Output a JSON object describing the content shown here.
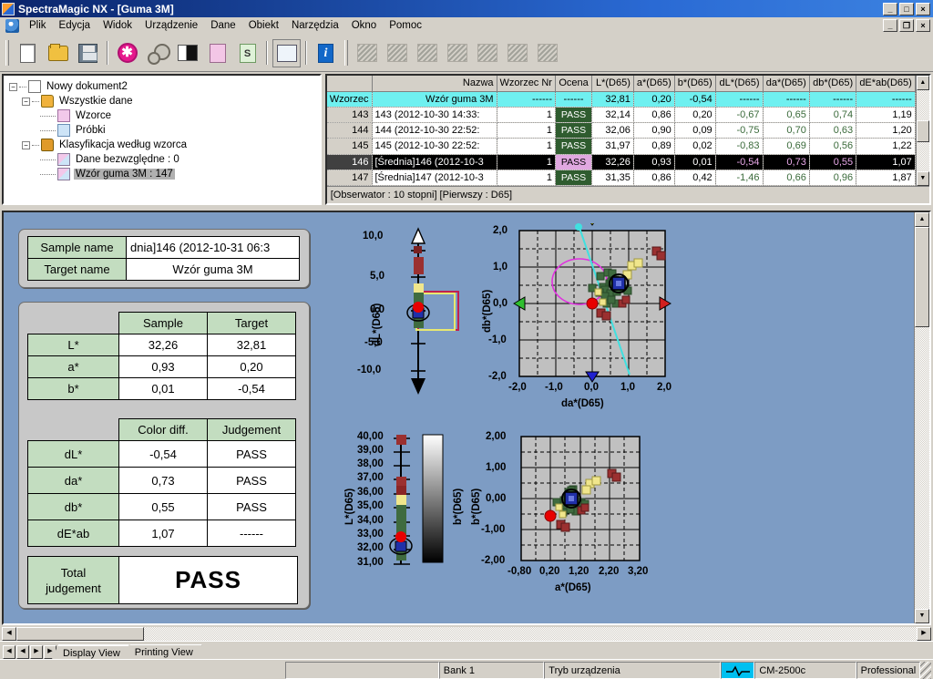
{
  "window": {
    "title": "SpectraMagic NX - [Guma 3M]",
    "app_icon": "app-icon",
    "outer_buttons": [
      "_",
      "□",
      "×"
    ],
    "inner_buttons": [
      "_",
      "❐",
      "×"
    ]
  },
  "menu": {
    "items": [
      {
        "label": "Plik"
      },
      {
        "label": "Edycja"
      },
      {
        "label": "Widok"
      },
      {
        "label": "Urządzenie"
      },
      {
        "label": "Dane"
      },
      {
        "label": "Obiekt"
      },
      {
        "label": "Narzędzia"
      },
      {
        "label": "Okno"
      },
      {
        "label": "Pomoc"
      }
    ]
  },
  "toolbar": {
    "icons": [
      "new-document-icon",
      "open-folder-icon",
      "save-disk-icon",
      "target-measure-icon",
      "gears-settings-icon",
      "black-white-sample-icon",
      "target-pink-icon",
      "sample-green-icon",
      "window-list-icon",
      "info-icon",
      "chart-icon-1",
      "chart-icon-2",
      "chart-icon-3",
      "chart-icon-4",
      "chart-icon-5",
      "chart-icon-6",
      "chart-icon-7"
    ]
  },
  "tree": {
    "nodes": [
      {
        "label": "Nowy dokument2",
        "icon": "document-icon",
        "level": 0,
        "expander": "-",
        "selected": false
      },
      {
        "label": "Wszystkie dane",
        "icon": "folder-icon",
        "level": 1,
        "expander": "-",
        "selected": false
      },
      {
        "label": "Wzorce",
        "icon": "target-page-icon",
        "level": 2,
        "expander": "",
        "selected": false
      },
      {
        "label": "Próbki",
        "icon": "sample-page-icon",
        "level": 2,
        "expander": "",
        "selected": false
      },
      {
        "label": "Klasyfikacja według wzorca",
        "icon": "folder-group-icon",
        "level": 1,
        "expander": "-",
        "selected": false
      },
      {
        "label": "Dane bezwzględne : 0",
        "icon": "dual-page-icon",
        "level": 2,
        "expander": "",
        "selected": false
      },
      {
        "label": "Wzór guma 3M : 147",
        "icon": "dual-page-icon",
        "level": 2,
        "expander": "",
        "selected": true
      }
    ]
  },
  "datagrid": {
    "columns": [
      "",
      "Nazwa",
      "Wzorzec Nr",
      "Ocena",
      "L*(D65)",
      "a*(D65)",
      "b*(D65)",
      "dL*(D65)",
      "da*(D65)",
      "db*(D65)",
      "dE*ab(D65)"
    ],
    "rows": [
      {
        "kind": "target",
        "no": "Wzorzec",
        "name": "Wzór guma 3M",
        "ref": "------",
        "judge": "------",
        "L": "32,81",
        "a": "0,20",
        "b": "-0,54",
        "dL": "------",
        "da": "------",
        "db": "------",
        "dE": "------"
      },
      {
        "kind": "sample",
        "no": "143",
        "name": "143 (2012-10-30 14:33:",
        "ref": "1",
        "judge": "PASS",
        "L": "32,14",
        "a": "0,86",
        "b": "0,20",
        "dL": "-0,67",
        "da": "0,65",
        "db": "0,74",
        "dE": "1,19"
      },
      {
        "kind": "sample",
        "no": "144",
        "name": "144 (2012-10-30 22:52:",
        "ref": "1",
        "judge": "PASS",
        "L": "32,06",
        "a": "0,90",
        "b": "0,09",
        "dL": "-0,75",
        "da": "0,70",
        "db": "0,63",
        "dE": "1,20"
      },
      {
        "kind": "sample",
        "no": "145",
        "name": "145 (2012-10-30 22:52:",
        "ref": "1",
        "judge": "PASS",
        "L": "31,97",
        "a": "0,89",
        "b": "0,02",
        "dL": "-0,83",
        "da": "0,69",
        "db": "0,56",
        "dE": "1,22"
      },
      {
        "kind": "selected",
        "no": "146",
        "name": "[Średnia]146 (2012-10-3",
        "ref": "1",
        "judge": "PASS",
        "L": "32,26",
        "a": "0,93",
        "b": "0,01",
        "dL": "-0,54",
        "da": "0,73",
        "db": "0,55",
        "dE": "1,07"
      },
      {
        "kind": "sample",
        "no": "147",
        "name": "[Średnia]147 (2012-10-3",
        "ref": "1",
        "judge": "PASS",
        "L": "31,35",
        "a": "0,86",
        "b": "0,42",
        "dL": "-1,46",
        "da": "0,66",
        "db": "0,96",
        "dE": "1,87"
      }
    ],
    "observer_line": "[Obserwator : 10 stopni]  [Pierwszy : D65]"
  },
  "display": {
    "names": {
      "sample_label": "Sample name",
      "sample_value": "dnia]146 (2012-10-31 06:3",
      "target_label": "Target name",
      "target_value": "Wzór guma 3M"
    },
    "values_table": {
      "headers": [
        "",
        "Sample",
        "Target"
      ],
      "rows": [
        {
          "label": "L*",
          "sample": "32,26",
          "target": "32,81"
        },
        {
          "label": "a*",
          "sample": "0,93",
          "target": "0,20"
        },
        {
          "label": "b*",
          "sample": "0,01",
          "target": "-0,54"
        }
      ]
    },
    "diff_table": {
      "headers": [
        "",
        "Color diff.",
        "Judgement"
      ],
      "rows": [
        {
          "label": "dL*",
          "value": "-0,54",
          "judgement": "PASS"
        },
        {
          "label": "da*",
          "value": "0,73",
          "judgement": "PASS"
        },
        {
          "label": "db*",
          "value": "0,55",
          "judgement": "PASS"
        },
        {
          "label": "dE*ab",
          "value": "1,07",
          "judgement": "------"
        }
      ]
    },
    "total": {
      "label_line1": "Total",
      "label_line2": "judgement",
      "value": "PASS"
    }
  },
  "chart_data": [
    {
      "type": "scatter",
      "name": "dL-axis-gauge",
      "title": "",
      "ylabel": "dL*(D65)",
      "ylim": [
        -10.0,
        10.0
      ],
      "yticks": [
        "10,0",
        "5,0",
        "0,0",
        "-5,0",
        "-10,0"
      ],
      "tolerance_box": {
        "upper": 2.5,
        "lower": -2.5
      },
      "current_value": -0.54,
      "grid": false
    },
    {
      "type": "scatter",
      "name": "da-db-diff-plot",
      "xlabel": "da*(D65)",
      "ylabel": "db*(D65)",
      "xlim": [
        -2.0,
        2.0
      ],
      "ylim": [
        -2.0,
        2.0
      ],
      "xticks": [
        "-2,0",
        "-1,0",
        "0,0",
        "1,0",
        "2,0"
      ],
      "yticks": [
        "-2,0",
        "-1,0",
        "0,0",
        "1,0",
        "2,0"
      ],
      "grid": true,
      "target_point": {
        "x": 0.0,
        "y": 0.0
      },
      "selected_point": {
        "x": 0.73,
        "y": 0.55
      },
      "tolerance_ellipse": {
        "cx": -0.1,
        "cy": 0.6,
        "rx": 0.75,
        "ry": 0.62
      },
      "series": [
        {
          "name": "samples-green",
          "color": "#3f6b3f",
          "points": [
            [
              0.65,
              0.74
            ],
            [
              0.7,
              0.63
            ],
            [
              0.69,
              0.56
            ],
            [
              0.66,
              0.96
            ],
            [
              0.4,
              0.85
            ],
            [
              0.55,
              0.9
            ],
            [
              0.3,
              0.55
            ],
            [
              0.48,
              0.62
            ],
            [
              0.35,
              0.45
            ],
            [
              0.6,
              0.5
            ],
            [
              0.52,
              0.38
            ],
            [
              0.28,
              0.4
            ],
            [
              0.58,
              0.7
            ],
            [
              0.44,
              0.3
            ],
            [
              0.68,
              0.42
            ],
            [
              0.18,
              0.52
            ],
            [
              0.8,
              0.55
            ],
            [
              0.9,
              0.48
            ],
            [
              0.36,
              0.05
            ],
            [
              0.62,
              0.1
            ],
            [
              0.5,
              0.25
            ]
          ]
        },
        {
          "name": "samples-yellow",
          "color": "#f0e68c",
          "points": [
            [
              1.05,
              1.05
            ],
            [
              1.22,
              1.12
            ],
            [
              0.95,
              0.8
            ],
            [
              0.25,
              0.45
            ],
            [
              0.4,
              0.15
            ]
          ]
        },
        {
          "name": "samples-red",
          "color": "#9b3030",
          "points": [
            [
              1.8,
              1.42
            ],
            [
              1.92,
              1.28
            ],
            [
              0.3,
              -0.22
            ],
            [
              0.45,
              -0.3
            ],
            [
              0.78,
              0.12
            ],
            [
              0.88,
              0.22
            ]
          ]
        }
      ]
    },
    {
      "type": "scatter",
      "name": "L-axis-gauge",
      "ylabel": "L*(D65)",
      "right_label": "b*(D65)",
      "ylim": [
        31.0,
        40.0
      ],
      "yticks": [
        "40,00",
        "39,00",
        "38,00",
        "37,00",
        "36,00",
        "35,00",
        "34,00",
        "33,00",
        "32,00",
        "31,00"
      ],
      "current_value": 32.26,
      "target_value": 32.81,
      "grid": false
    },
    {
      "type": "scatter",
      "name": "a-b-absolute-plot",
      "xlabel": "a*(D65)",
      "ylabel": "b*(D65)",
      "xlim": [
        -0.8,
        3.2
      ],
      "ylim": [
        -2.0,
        2.0
      ],
      "xticks": [
        "-0,80",
        "0,20",
        "1,20",
        "2,20",
        "3,20"
      ],
      "yticks": [
        "-2,00",
        "-1,00",
        "0,00",
        "1,00",
        "2,00"
      ],
      "grid": true,
      "target_point": {
        "x": 0.2,
        "y": -0.54
      },
      "selected_point": {
        "x": 0.93,
        "y": 0.01
      },
      "series": [
        {
          "name": "samples-green",
          "color": "#3f6b3f",
          "points": [
            [
              0.86,
              0.2
            ],
            [
              0.9,
              0.09
            ],
            [
              0.89,
              0.02
            ],
            [
              0.86,
              0.42
            ],
            [
              0.72,
              0.33
            ],
            [
              0.8,
              0.38
            ],
            [
              0.62,
              0.05
            ],
            [
              0.75,
              0.12
            ],
            [
              0.68,
              -0.05
            ],
            [
              0.84,
              -0.02
            ],
            [
              0.78,
              -0.12
            ],
            [
              0.6,
              -0.1
            ],
            [
              0.82,
              0.25
            ],
            [
              0.7,
              -0.18
            ],
            [
              0.92,
              -0.08
            ],
            [
              0.52,
              0.02
            ],
            [
              1.0,
              0.05
            ],
            [
              1.1,
              0.0
            ],
            [
              0.66,
              -0.22
            ],
            [
              0.88,
              -0.25
            ],
            [
              0.76,
              -0.15
            ]
          ]
        },
        {
          "name": "samples-yellow",
          "color": "#f0e68c",
          "points": [
            [
              1.28,
              0.55
            ],
            [
              1.42,
              0.6
            ],
            [
              1.18,
              0.32
            ],
            [
              0.55,
              -0.05
            ],
            [
              0.7,
              -0.35
            ]
          ]
        },
        {
          "name": "samples-red",
          "color": "#9b3030",
          "points": [
            [
              2.02,
              0.92
            ],
            [
              2.12,
              0.78
            ],
            [
              0.58,
              -0.72
            ],
            [
              0.68,
              -0.8
            ],
            [
              1.02,
              -0.38
            ],
            [
              1.12,
              -0.28
            ]
          ]
        }
      ]
    }
  ],
  "tabs": {
    "nav": [
      "◀◀",
      "◀",
      "▶",
      "▶▶"
    ],
    "items": [
      {
        "label": "Display View",
        "active": true
      },
      {
        "label": "Printing View",
        "active": false
      }
    ]
  },
  "statusbar": {
    "fields": [
      "",
      "",
      "Bank 1",
      "Tryb urządzenia",
      "",
      "CM-2500c",
      "Professional"
    ],
    "connection_icon": "device-connected-icon"
  }
}
